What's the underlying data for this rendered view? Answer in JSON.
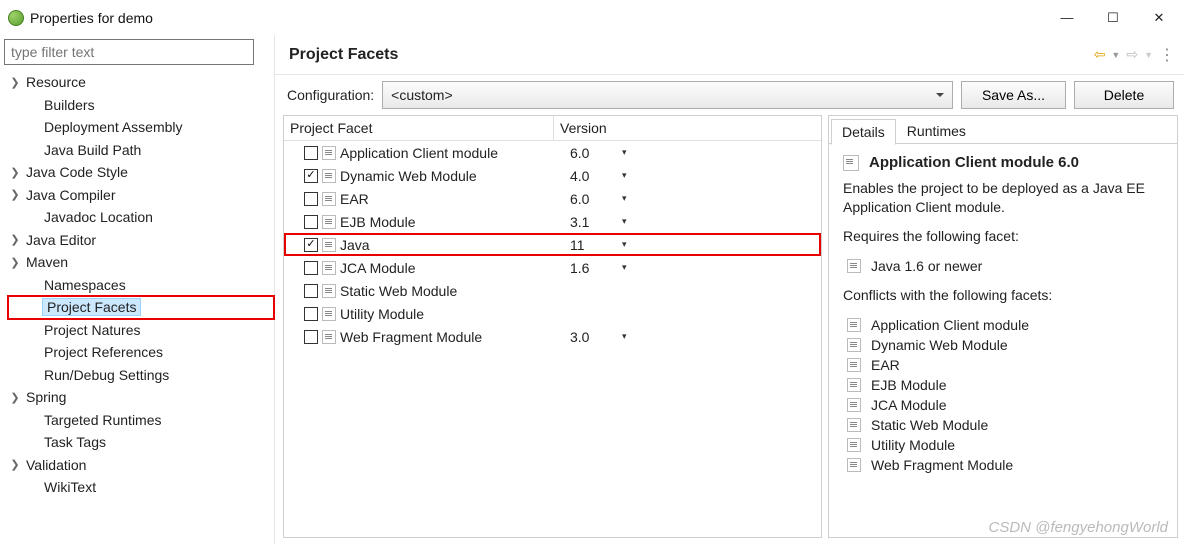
{
  "window": {
    "title": "Properties for demo"
  },
  "filter": {
    "placeholder": "type filter text"
  },
  "tree": [
    {
      "label": "Resource",
      "expandable": true,
      "indent": 0
    },
    {
      "label": "Builders",
      "expandable": false,
      "indent": 1
    },
    {
      "label": "Deployment Assembly",
      "expandable": false,
      "indent": 1
    },
    {
      "label": "Java Build Path",
      "expandable": false,
      "indent": 1
    },
    {
      "label": "Java Code Style",
      "expandable": true,
      "indent": 0
    },
    {
      "label": "Java Compiler",
      "expandable": true,
      "indent": 0
    },
    {
      "label": "Javadoc Location",
      "expandable": false,
      "indent": 1
    },
    {
      "label": "Java Editor",
      "expandable": true,
      "indent": 0
    },
    {
      "label": "Maven",
      "expandable": true,
      "indent": 0
    },
    {
      "label": "Namespaces",
      "expandable": false,
      "indent": 1
    },
    {
      "label": "Project Facets",
      "expandable": false,
      "indent": 1,
      "selected": true,
      "boxed": true
    },
    {
      "label": "Project Natures",
      "expandable": false,
      "indent": 1
    },
    {
      "label": "Project References",
      "expandable": false,
      "indent": 1
    },
    {
      "label": "Run/Debug Settings",
      "expandable": false,
      "indent": 1
    },
    {
      "label": "Spring",
      "expandable": true,
      "indent": 0
    },
    {
      "label": "Targeted Runtimes",
      "expandable": false,
      "indent": 1
    },
    {
      "label": "Task Tags",
      "expandable": false,
      "indent": 1
    },
    {
      "label": "Validation",
      "expandable": true,
      "indent": 0
    },
    {
      "label": "WikiText",
      "expandable": false,
      "indent": 1
    }
  ],
  "page": {
    "title": "Project Facets",
    "config_label": "Configuration:",
    "config_value": "<custom>",
    "save_as": "Save As...",
    "delete": "Delete"
  },
  "facet_table": {
    "head_name": "Project Facet",
    "head_version": "Version",
    "rows": [
      {
        "name": "Application Client module",
        "version": "6.0",
        "checked": false,
        "caret": true
      },
      {
        "name": "Dynamic Web Module",
        "version": "4.0",
        "checked": true,
        "caret": true
      },
      {
        "name": "EAR",
        "version": "6.0",
        "checked": false,
        "caret": true
      },
      {
        "name": "EJB Module",
        "version": "3.1",
        "checked": false,
        "caret": true
      },
      {
        "name": "Java",
        "version": "11",
        "checked": true,
        "caret": true,
        "boxed": true
      },
      {
        "name": "JCA Module",
        "version": "1.6",
        "checked": false,
        "caret": true
      },
      {
        "name": "Static Web Module",
        "version": "",
        "checked": false,
        "caret": false
      },
      {
        "name": "Utility Module",
        "version": "",
        "checked": false,
        "caret": false
      },
      {
        "name": "Web Fragment Module",
        "version": "3.0",
        "checked": false,
        "caret": true
      }
    ]
  },
  "details": {
    "tab_details": "Details",
    "tab_runtimes": "Runtimes",
    "title": "Application Client module 6.0",
    "desc": "Enables the project to be deployed as a Java EE Application Client module.",
    "requires_label": "Requires the following facet:",
    "requires": [
      "Java 1.6 or newer"
    ],
    "conflicts_label": "Conflicts with the following facets:",
    "conflicts": [
      "Application Client module",
      "Dynamic Web Module",
      "EAR",
      "EJB Module",
      "JCA Module",
      "Static Web Module",
      "Utility Module",
      "Web Fragment Module"
    ]
  },
  "watermark": "CSDN @fengyehongWorld"
}
